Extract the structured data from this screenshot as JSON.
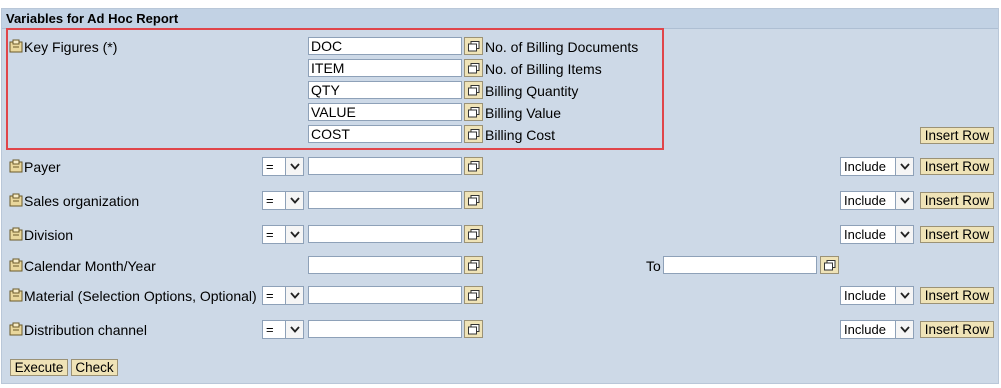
{
  "panel": {
    "title": "Variables for Ad Hoc Report"
  },
  "key_figures": {
    "label": "Key Figures (*)",
    "rows": [
      {
        "value": "DOC",
        "description": "No. of Billing Documents"
      },
      {
        "value": "ITEM",
        "description": "No. of Billing Items"
      },
      {
        "value": "QTY",
        "description": "Billing Quantity"
      },
      {
        "value": "VALUE",
        "description": "Billing Value"
      },
      {
        "value": "COST",
        "description": "Billing Cost"
      }
    ],
    "insert_row": "Insert Row"
  },
  "variables": [
    {
      "label": "Payer",
      "operator": "=",
      "value": "",
      "option": "Include",
      "insert_row": "Insert Row"
    },
    {
      "label": "Sales organization",
      "operator": "=",
      "value": "",
      "option": "Include",
      "insert_row": "Insert Row"
    },
    {
      "label": "Division",
      "operator": "=",
      "value": "",
      "option": "Include",
      "insert_row": "Insert Row"
    },
    {
      "label": "Calendar Month/Year",
      "value": "",
      "to_label": "To",
      "to_value": ""
    },
    {
      "label": "Material (Selection Options, Optional)",
      "operator": "=",
      "value": "",
      "option": "Include",
      "insert_row": "Insert Row"
    },
    {
      "label": "Distribution channel",
      "operator": "=",
      "value": "",
      "option": "Include",
      "insert_row": "Insert Row"
    }
  ],
  "actions": {
    "execute": "Execute",
    "check": "Check"
  },
  "colors": {
    "panel_bg": "#cdd9e7",
    "button_bg": "#efe3b7",
    "highlight": "#e0454a"
  },
  "icons": {
    "variable": "variable-icon",
    "value_help": "value-help-icon",
    "dropdown": "chevron-down-icon"
  }
}
